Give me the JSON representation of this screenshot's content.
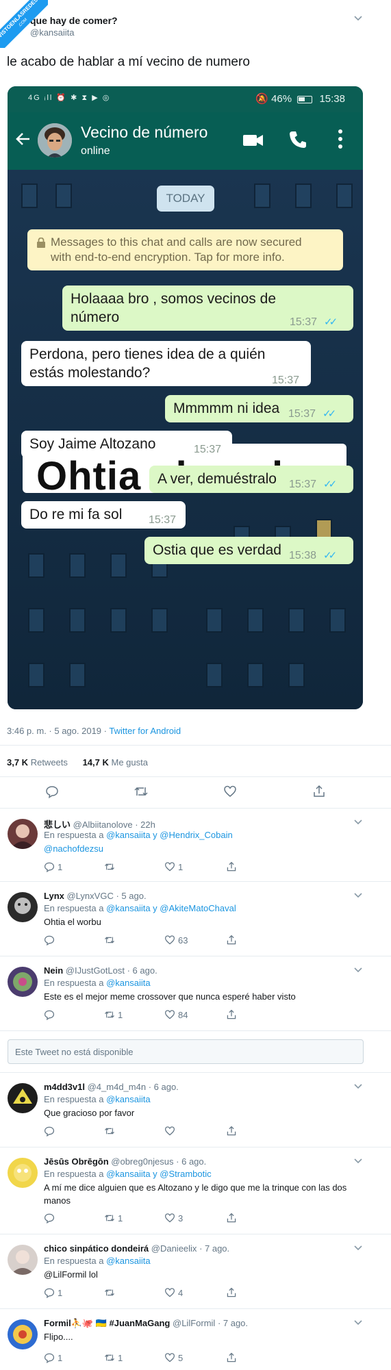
{
  "watermark": {
    "line1": "VISTOENLASREDES",
    "line2": ".COM"
  },
  "tweet": {
    "author_name": "que hay de comer?",
    "author_handle": "@kansaiita",
    "text": "le acabo de hablar a mí vecino de numero",
    "timestamp": "3:46 p. m. · 5 ago. 2019 · ",
    "source": "Twitter for Android",
    "retweets_count": "3,7 K",
    "retweets_label": "Retweets",
    "likes_count": "14,7 K",
    "likes_label": "Me gusta"
  },
  "phone": {
    "status_left": "4G ᵢll ⏰ ✱ ⧗ ▶ ◎",
    "battery_pct": "46%",
    "clock": "15:38",
    "contact_name": "Vecino de número",
    "contact_status": "online",
    "date_chip": "TODAY",
    "encryption_notice_1": "Messages to this chat and calls are now secured",
    "encryption_notice_2": "with end-to-end encryption. Tap for more info.",
    "banner_text": "Ohtia el worbu",
    "messages": [
      {
        "dir": "out",
        "line1": "Holaaaa bro , somos vecinos de",
        "line2": "número",
        "time": "15:37"
      },
      {
        "dir": "in",
        "line1": "Perdona, pero tienes idea de a quién",
        "line2": "estás molestando?",
        "time": "15:37"
      },
      {
        "dir": "out",
        "line1": "Mmmmm ni idea",
        "line2": "",
        "time": "15:37"
      },
      {
        "dir": "in",
        "line1": "Soy Jaime Altozano",
        "line2": "",
        "time": "15:37"
      },
      {
        "dir": "out",
        "line1": "A ver, demuéstralo",
        "line2": "",
        "time": "15:37"
      },
      {
        "dir": "in",
        "line1": "Do re mi fa sol",
        "line2": "",
        "time": "15:37"
      },
      {
        "dir": "out",
        "line1": "Ostia que es verdad",
        "line2": "",
        "time": "15:38"
      }
    ]
  },
  "replies": [
    {
      "name": "悲しい",
      "handle": "@Albiitanolove",
      "time": "· 22h",
      "reply_prefix": "En respuesta a ",
      "reply_to": "@kansaiita y @Hendrix_Cobain",
      "text": "@nachofdezsu",
      "replies": "1",
      "retweets": "",
      "likes": "1"
    },
    {
      "name": "Lynx",
      "handle": "@LynxVGC",
      "time": "· 5 ago.",
      "reply_prefix": "En respuesta a ",
      "reply_to": "@kansaiita y @AkiteMatoChaval",
      "text": "Ohtia el worbu",
      "replies": "",
      "retweets": "",
      "likes": "63"
    },
    {
      "name": "Nein",
      "handle": "@IJustGotLost",
      "time": "· 6 ago.",
      "reply_prefix": "En respuesta a ",
      "reply_to": "@kansaiita",
      "text": "Este es el mejor meme crossover que nunca esperé haber visto",
      "replies": "",
      "retweets": "1",
      "likes": "84"
    },
    {
      "name": "m4dd3v1l",
      "handle": "@4_m4d_m4n",
      "time": "· 6 ago.",
      "reply_prefix": "En respuesta a ",
      "reply_to": "@kansaiita",
      "text": "Que gracioso por favor",
      "replies": "",
      "retweets": "",
      "likes": ""
    },
    {
      "name": "Jēsūs Obrēgōn",
      "handle": "@obreg0njesus",
      "time": "· 6 ago.",
      "reply_prefix": "En respuesta a ",
      "reply_to": "@kansaiita y @Strambotic",
      "text": "A mí me dice alguien que es Altozano y le digo que me la trinque con las dos manos",
      "replies": "",
      "retweets": "1",
      "likes": "3"
    },
    {
      "name": "chico sinpático dondeirá",
      "handle": "@Danieelix",
      "time": "· 7 ago.",
      "reply_prefix": "En respuesta a ",
      "reply_to": "@kansaiita",
      "text": "@LilFormil lol",
      "replies": "1",
      "retweets": "",
      "likes": "4"
    },
    {
      "name": "Formil⛹🐙 🇺🇦 #JuanMaGang",
      "handle": "@LilFormil",
      "time": "· 7 ago.",
      "reply_prefix": "",
      "reply_to": "",
      "text": "Flipo....",
      "replies": "1",
      "retweets": "1",
      "likes": "5"
    }
  ],
  "unavailable_text": "Este Tweet no está disponible",
  "colors": {
    "whatsapp_header": "#075e54",
    "outgoing_bubble": "#dcf8c6",
    "link": "#1b95e0"
  }
}
